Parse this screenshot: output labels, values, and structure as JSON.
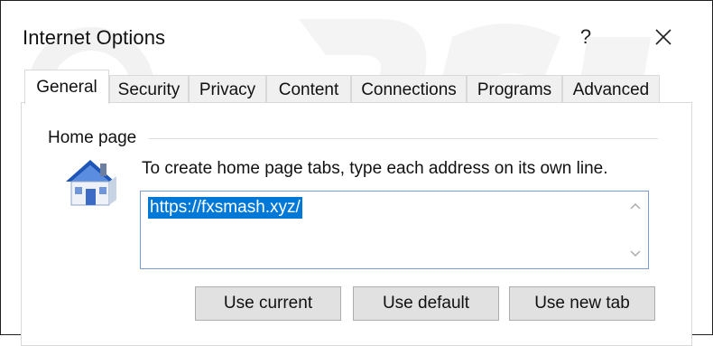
{
  "window": {
    "title": "Internet Options"
  },
  "title_buttons": {
    "help": "?",
    "close": "✕"
  },
  "tabs": [
    {
      "label": "General",
      "active": true
    },
    {
      "label": "Security"
    },
    {
      "label": "Privacy"
    },
    {
      "label": "Content"
    },
    {
      "label": "Connections"
    },
    {
      "label": "Programs"
    },
    {
      "label": "Advanced"
    }
  ],
  "home_page": {
    "group_label": "Home page",
    "instruction": "To create home page tabs, type each address on its own line.",
    "url": "https://fxsmash.xyz/"
  },
  "buttons": {
    "use_current": "Use current",
    "use_default": "Use default",
    "use_new_tab": "Use new tab"
  },
  "icons": {
    "home": "house-icon",
    "scroll_up": "chevron-up-icon",
    "scroll_down": "chevron-down-icon"
  },
  "colors": {
    "selection": "#0078d7",
    "textbox_border": "#7a9cd6",
    "button_bg": "#e1e1e1",
    "tab_bg": "#f0f0f0"
  }
}
